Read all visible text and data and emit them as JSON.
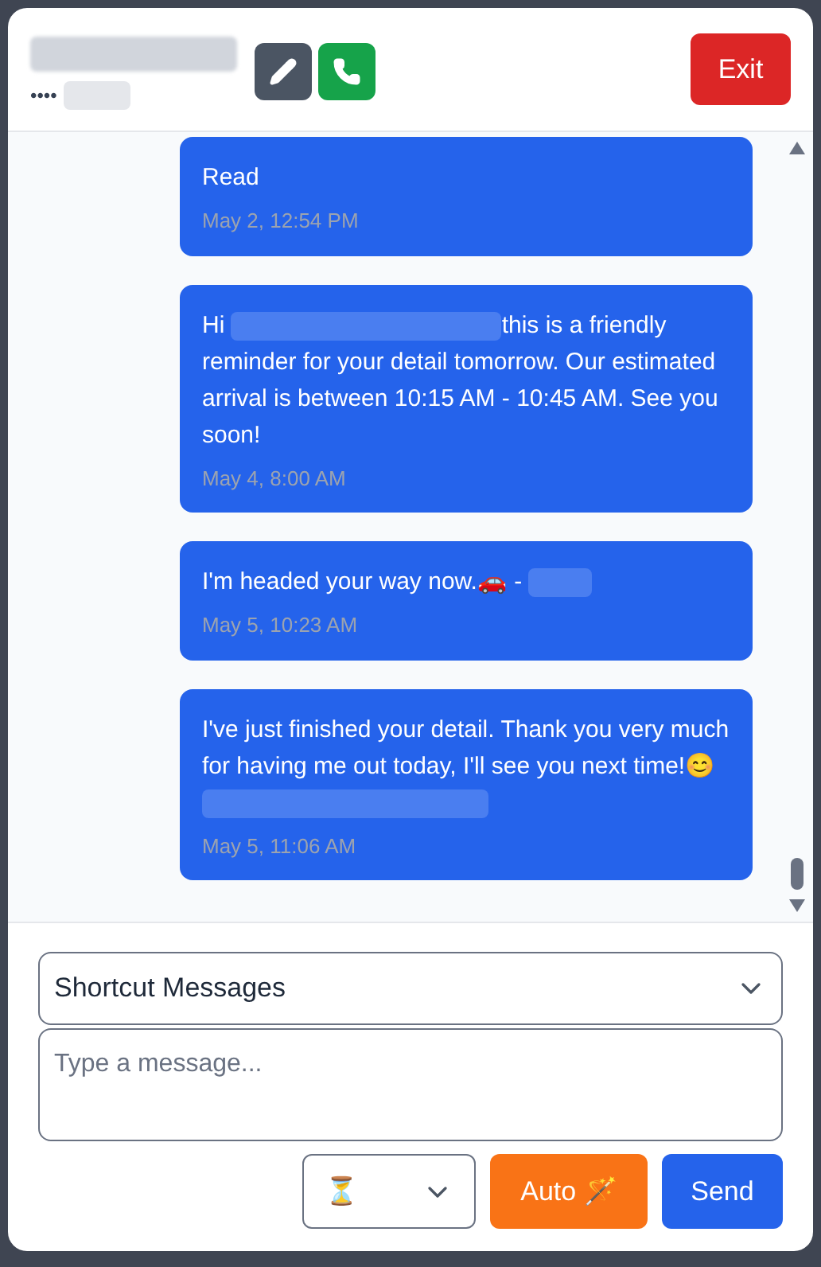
{
  "header": {
    "contact_masked": "••••",
    "exit": "Exit"
  },
  "messages": [
    {
      "segments": [
        {
          "kind": "text",
          "text": "Read"
        }
      ],
      "time": "May 2, 12:54 PM"
    },
    {
      "segments": [
        {
          "kind": "text",
          "text": "Hi"
        },
        {
          "kind": "redacted"
        },
        {
          "kind": "text",
          "text": "this is a friendly reminder for your detail tomorrow. Our estimated arrival is between 10:15 AM - 10:45 AM. See you soon!"
        }
      ],
      "time": "May 4, 8:00 AM"
    },
    {
      "segments": [
        {
          "kind": "text",
          "text": "I'm headed your way now.🚗 -"
        },
        {
          "kind": "redacted"
        }
      ],
      "time": "May 5, 10:23 AM"
    },
    {
      "segments": [
        {
          "kind": "text",
          "text": "I've just finished your detail. Thank you very much for having me out today, I'll see you next time!😊"
        },
        {
          "kind": "redacted"
        }
      ],
      "time": "May 5, 11:06 AM"
    }
  ],
  "composer": {
    "shortcut": "Shortcut Messages",
    "placeholder": "Type a message...",
    "delay": "⏳",
    "auto": "Auto 🪄",
    "send": "Send"
  }
}
